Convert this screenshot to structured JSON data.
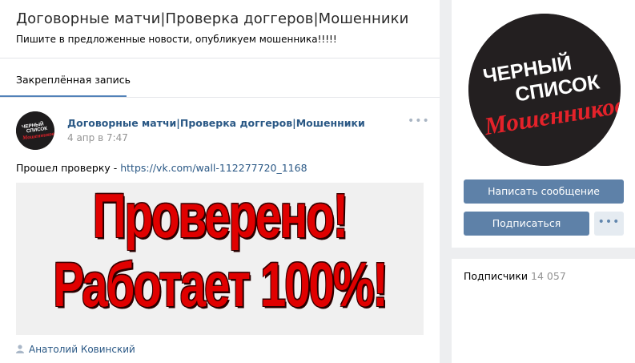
{
  "group": {
    "title": "Договорные матчи|Проверка доггеров|Мошенники",
    "status": "Пишите в предложенные новости, опубликуем мошенника!!!!!"
  },
  "tabs": [
    {
      "label": "Закреплённая запись"
    }
  ],
  "post": {
    "author": "Договорные матчи|Проверка доггеров|Мошенники",
    "date": "4 апр в 7:47",
    "more": "•••",
    "text_prefix": "Прошел проверку - ",
    "link": "https://vk.com/wall-112277720_1168",
    "image_line1": "Проверено!",
    "image_line2": "Работает 100%!",
    "signer": "Анатолий Ковинский",
    "avatar_text": {
      "line1": "ЧЕРНЫЙ",
      "line2": "СПИСОК",
      "line3": "Мошенников"
    }
  },
  "cover": {
    "line1": "ЧЕРНЫЙ",
    "line2": "СПИСОК",
    "line3": "Мошенников"
  },
  "actions": {
    "message_label": "Написать сообщение",
    "subscribe_label": "Подписаться",
    "more_label": "•••"
  },
  "subscribers": {
    "label": "Подписчики",
    "count": "14 057"
  },
  "colors": {
    "accent": "#5181b8",
    "button": "#5e81a8",
    "link": "#2a5885",
    "image_text": "#e00000",
    "background": "#edeef0"
  }
}
